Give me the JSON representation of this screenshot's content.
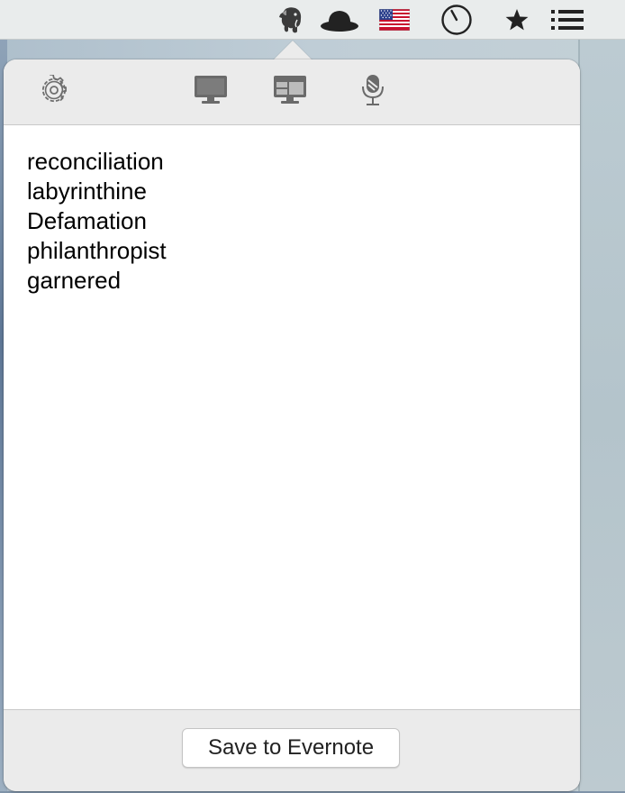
{
  "menubar": {
    "icons": [
      "evernote-elephant-icon",
      "bowler-hat-icon",
      "us-flag-icon",
      "clock-icon",
      "star-icon",
      "list-icon"
    ]
  },
  "popover": {
    "toolbar": {
      "icons": [
        "gear-icon",
        "monitor-icon",
        "window-grid-icon",
        "microphone-icon"
      ]
    },
    "note": {
      "lines": [
        "reconciliation",
        "labyrinthine",
        "Defamation",
        "philanthropist",
        "garnered"
      ]
    },
    "footer": {
      "save_label": "Save to Evernote"
    }
  },
  "colors": {
    "menubar_bg": "#e9ecec",
    "popover_bg": "#ebebeb",
    "icon_gray": "#6e6e6e",
    "text": "#000000"
  }
}
